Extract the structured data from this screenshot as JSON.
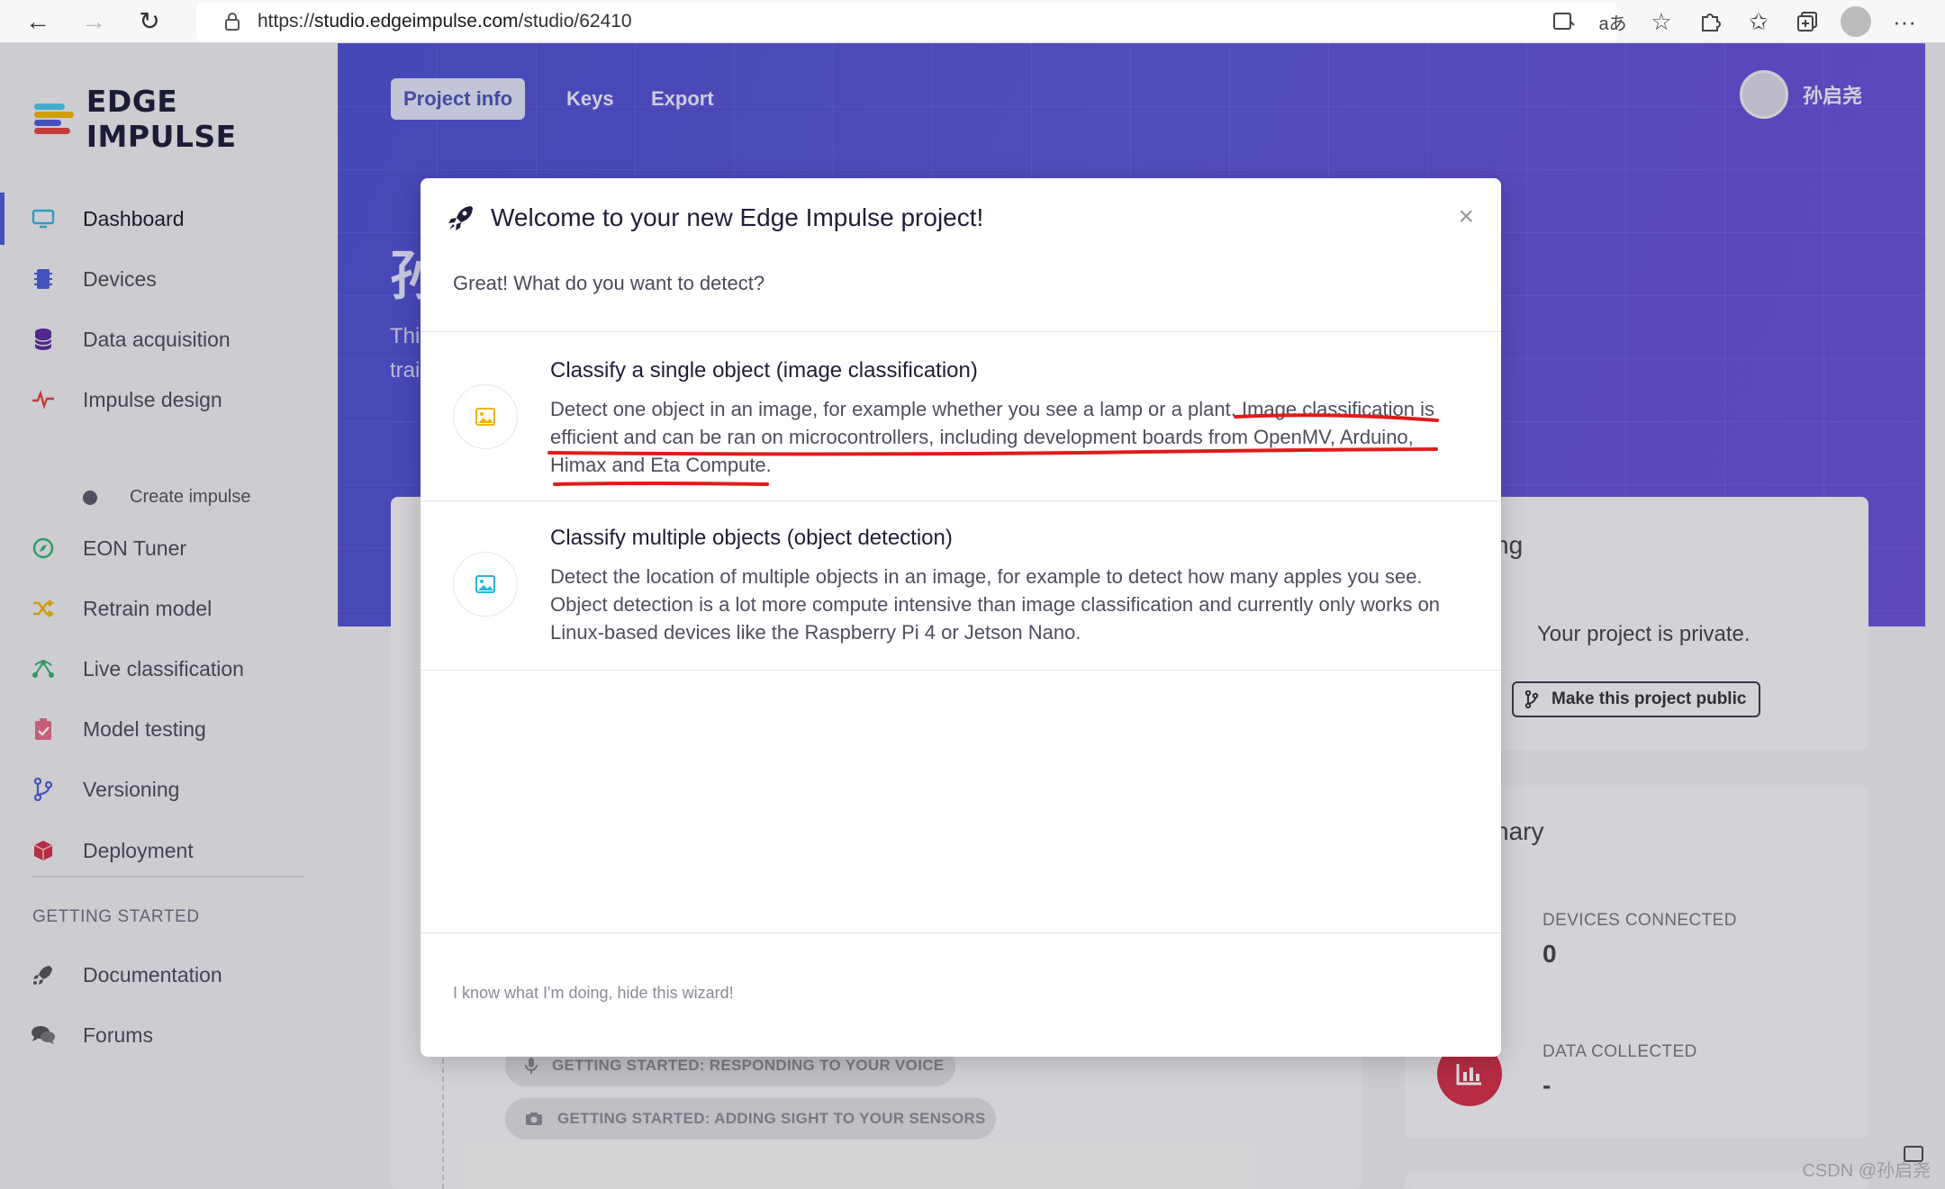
{
  "browser": {
    "url_prefix": "https://",
    "url_host": "studio.edgeimpulse.com",
    "url_path": "/studio/62410"
  },
  "sidebar": {
    "logo_text": "EDGE IMPULSE",
    "items": [
      {
        "label": "Dashboard"
      },
      {
        "label": "Devices"
      },
      {
        "label": "Data acquisition"
      },
      {
        "label": "Impulse design"
      },
      {
        "label": "Create impulse"
      },
      {
        "label": "EON Tuner"
      },
      {
        "label": "Retrain model"
      },
      {
        "label": "Live classification"
      },
      {
        "label": "Model testing"
      },
      {
        "label": "Versioning"
      },
      {
        "label": "Deployment"
      }
    ],
    "getting_started_heading": "GETTING STARTED",
    "getting_started_items": [
      {
        "label": "Documentation"
      },
      {
        "label": "Forums"
      }
    ]
  },
  "header": {
    "tabs": [
      {
        "label": "Project info"
      },
      {
        "label": "Keys"
      },
      {
        "label": "Export"
      }
    ],
    "user_name": "孙启尧",
    "title_fragment": "孙",
    "text_fragment_1": "Thi",
    "text_fragment_2": "trai"
  },
  "background": {
    "sharing_fragment": "ng",
    "private_text": "Your project is private.",
    "make_public_label": "Make this project public",
    "summary_fragment": "nary",
    "devices_connected_label": "DEVICES CONNECTED",
    "devices_connected_value": "0",
    "data_collected_label": "DATA COLLECTED",
    "data_collected_value": "-",
    "getting_started_voice": "GETTING STARTED: RESPONDING TO YOUR VOICE",
    "getting_started_sight": "GETTING STARTED: ADDING SIGHT TO YOUR SENSORS"
  },
  "modal": {
    "title": "Welcome to your new Edge Impulse project!",
    "close_label": "×",
    "subtitle": "Great! What do you want to detect?",
    "options": [
      {
        "title": "Classify a single object (image classification)",
        "desc_lines": [
          "Detect one object in an image, for example whether you see a lamp or a plant. Image classification is",
          "efficient and can be ran on microcontrollers, including development boards from OpenMV, Arduino,",
          "Himax and Eta Compute."
        ]
      },
      {
        "title": "Classify multiple objects (object detection)",
        "desc_lines": [
          "Detect the location of multiple objects in an image, for example to detect how many apples you see.",
          "Object detection is a lot more compute intensive than image classification and currently only works on",
          "Linux-based devices like the Raspberry Pi 4 or Jetson Nano."
        ]
      }
    ],
    "hide_link": "I know what I'm doing, hide this wizard!"
  },
  "watermark": "CSDN @孙启尧",
  "colors": {
    "accent": "#4a5bd8",
    "hero": "#5a55d4",
    "annotation_red": "#e01b1b",
    "icon_yellow": "#f0b400",
    "icon_cyan": "#26b5e0"
  }
}
